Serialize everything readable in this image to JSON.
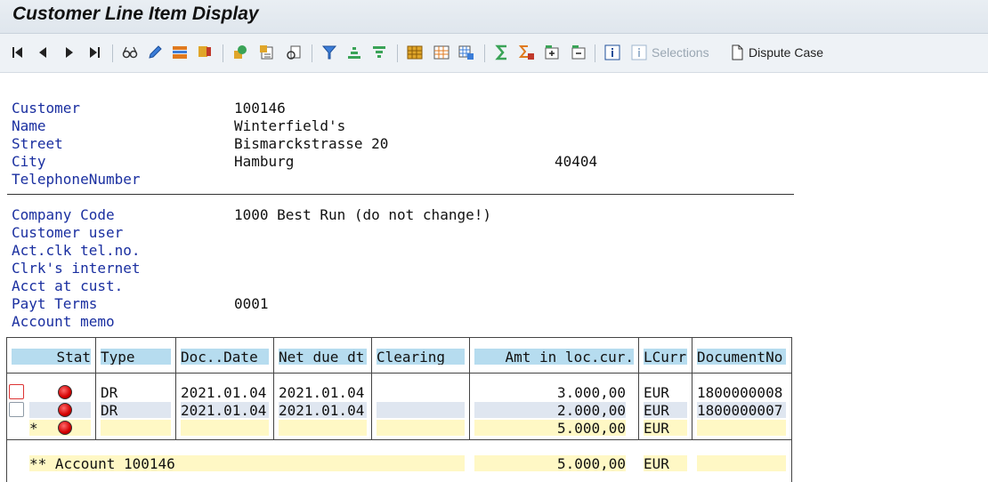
{
  "window": {
    "title": "Customer Line Item Display"
  },
  "toolbar": {
    "selections_label": "Selections",
    "dispute_case_label": "Dispute Case"
  },
  "header": {
    "customer_label": "Customer",
    "customer_value": "100146",
    "name_label": "Name",
    "name_value": "Winterfield's",
    "street_label": "Street",
    "street_value": "Bismarckstrasse 20",
    "city_label": "City",
    "city_value": "Hamburg",
    "postal_code": "40404",
    "telephone_label": "TelephoneNumber"
  },
  "company": {
    "company_code_label": "Company Code",
    "company_code_value": "1000 Best Run (do not change!)",
    "customer_user_label": "Customer user",
    "act_clk_label": "Act.clk tel.no.",
    "clrk_internet_label": "Clrk's internet",
    "acct_at_cust_label": "Acct at cust.",
    "payt_terms_label": "Payt Terms",
    "payt_terms_value": "0001",
    "account_memo_label": "Account memo"
  },
  "table": {
    "columns": [
      "Stat",
      "Type",
      "Doc..Date",
      "Net due dt",
      "Clearing",
      "Amt in loc.cur.",
      "LCurr",
      "DocumentNo"
    ],
    "rows": [
      {
        "type": "DR",
        "doc_date": "2021.01.04",
        "net_due": "2021.01.04",
        "clearing": "",
        "amount": "3.000,00",
        "currency": "EUR",
        "doc_no": "1800000008"
      },
      {
        "type": "DR",
        "doc_date": "2021.01.04",
        "net_due": "2021.01.04",
        "clearing": "",
        "amount": "2.000,00",
        "currency": "EUR",
        "doc_no": "1800000007"
      }
    ],
    "subtotal": {
      "marker": "*",
      "amount": "5.000,00",
      "currency": "EUR"
    },
    "total": {
      "label": "** Account 100146",
      "amount": "5.000,00",
      "currency": "EUR"
    }
  },
  "colors": {
    "label_blue": "#1a2fa0",
    "header_cell": "#b6dcef",
    "total_yellow": "#fff8c5",
    "status_red": "#d40000"
  }
}
